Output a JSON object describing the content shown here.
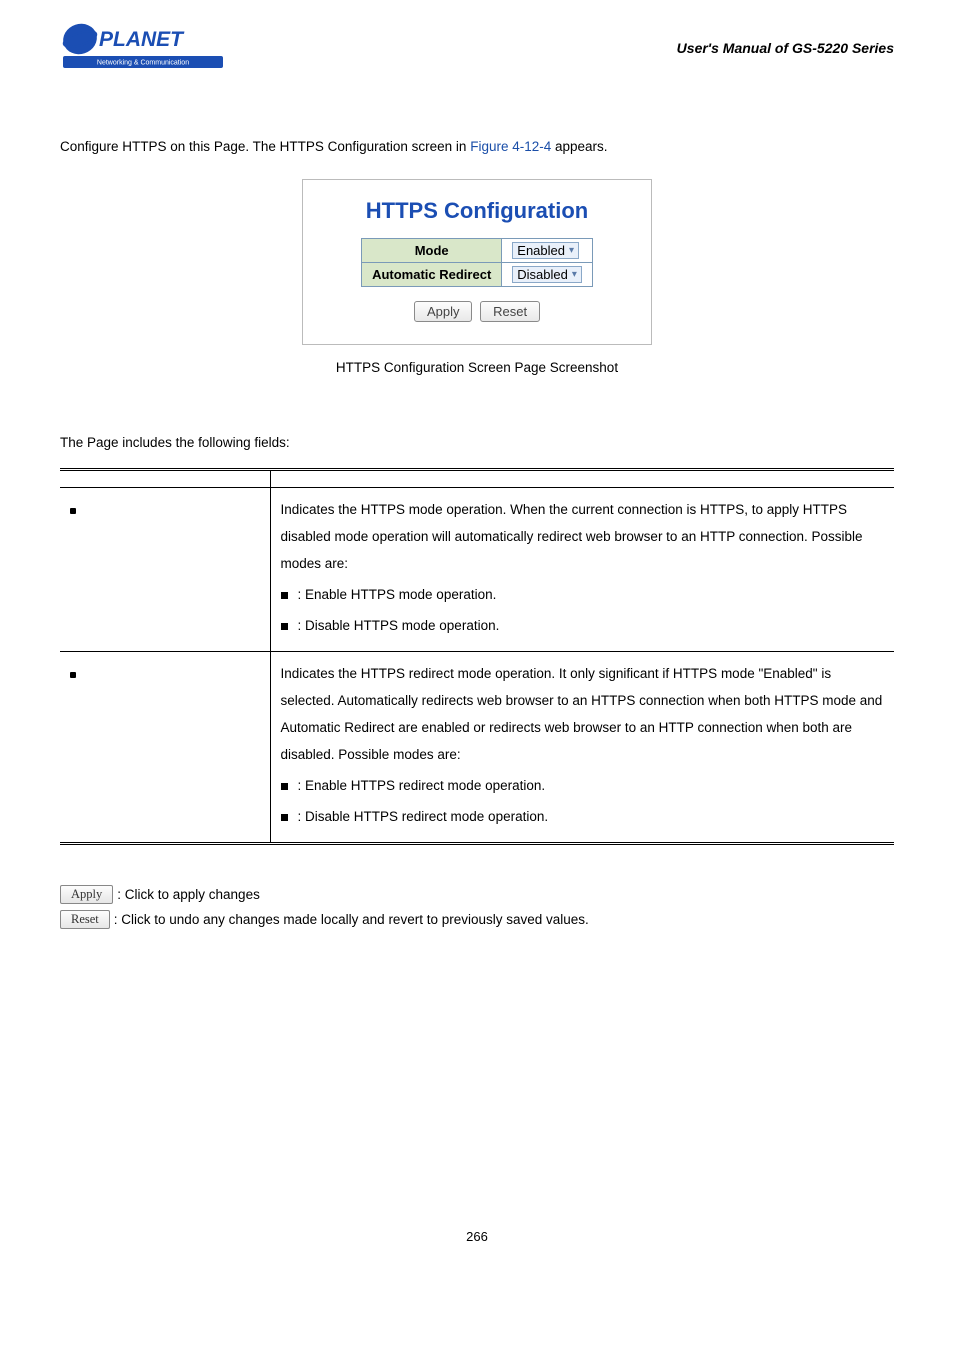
{
  "header": {
    "logo_top": "PLANET",
    "logo_sub": "Networking & Communication",
    "title": "User's Manual of GS-5220 Series"
  },
  "intro": {
    "pre": "Configure HTTPS on this Page. The HTTPS Configuration screen in ",
    "figref": "Figure 4-12-4",
    "post": " appears."
  },
  "config": {
    "title": "HTTPS Configuration",
    "rows": [
      {
        "label": "Mode",
        "value": "Enabled"
      },
      {
        "label": "Automatic Redirect",
        "value": "Disabled"
      }
    ],
    "apply": "Apply",
    "reset": "Reset"
  },
  "caption": "HTTPS Configuration Screen Page Screenshot",
  "fields_intro": "The Page includes the following fields:",
  "table_header": {
    "object": "",
    "description": ""
  },
  "rows": [
    {
      "object": "",
      "desc": "Indicates the HTTPS mode operation. When the current connection is HTTPS, to apply HTTPS disabled mode operation will automatically redirect web browser to an HTTP connection. Possible modes are:",
      "opts": [
        {
          "label": "",
          "text": ": Enable HTTPS mode operation."
        },
        {
          "label": "",
          "text": ": Disable HTTPS mode operation."
        }
      ]
    },
    {
      "object": "",
      "desc": "Indicates the HTTPS redirect mode operation. It only significant if HTTPS mode \"Enabled\" is selected. Automatically redirects web browser to an HTTPS connection when both HTTPS mode and Automatic Redirect are enabled or redirects web browser to an HTTP connection when both are disabled. Possible modes are:",
      "opts": [
        {
          "label": "",
          "text": ": Enable HTTPS redirect mode operation."
        },
        {
          "label": "",
          "text": ": Disable HTTPS redirect mode operation."
        }
      ]
    }
  ],
  "buttons": {
    "apply": {
      "label": "Apply",
      "desc": ": Click to apply changes"
    },
    "reset": {
      "label": "Reset",
      "desc": ": Click to undo any changes made locally and revert to previously saved values."
    }
  },
  "page_number": "266"
}
